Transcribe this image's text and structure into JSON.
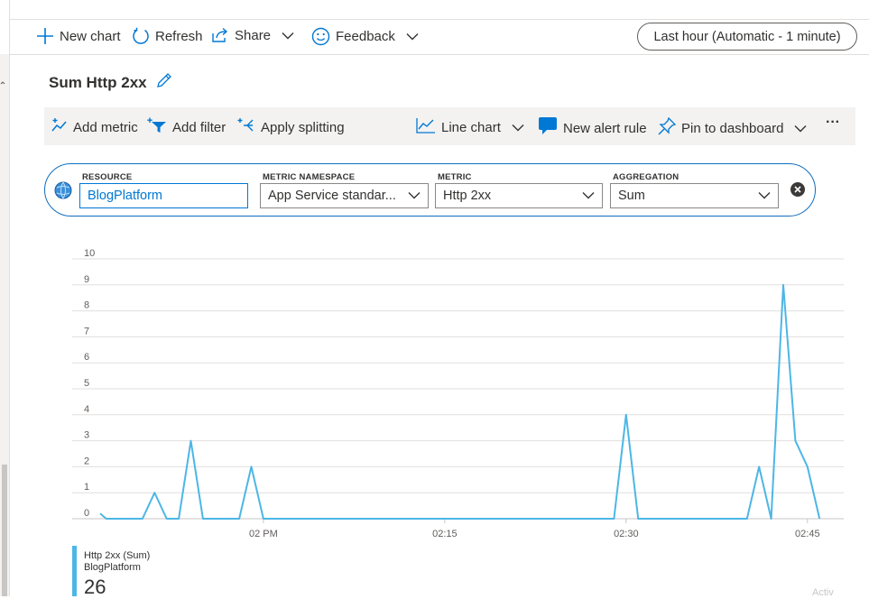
{
  "commandbar": {
    "new_chart": "New chart",
    "refresh": "Refresh",
    "share": "Share",
    "feedback": "Feedback",
    "time_range": "Last hour (Automatic - 1 minute)"
  },
  "chart_title": "Sum Http 2xx",
  "toolbar": {
    "add_metric": "Add metric",
    "add_filter": "Add filter",
    "apply_splitting": "Apply splitting",
    "line_chart": "Line chart",
    "new_alert_rule": "New alert rule",
    "pin_to_dashboard": "Pin to dashboard",
    "more": "···"
  },
  "metric_row": {
    "resource_label": "RESOURCE",
    "resource_value": "BlogPlatform",
    "namespace_label": "METRIC NAMESPACE",
    "namespace_value": "App Service standar...",
    "metric_label": "METRIC",
    "metric_value": "Http 2xx",
    "aggregation_label": "AGGREGATION",
    "aggregation_value": "Sum"
  },
  "chart_data": {
    "type": "line",
    "y_ticks": [
      "0",
      "1",
      "2",
      "3",
      "4",
      "5",
      "6",
      "7",
      "8",
      "9",
      "10"
    ],
    "ylim": [
      0,
      10
    ],
    "x_ticks": [
      {
        "label": "02 PM",
        "minute": 0
      },
      {
        "label": "02:15",
        "minute": 15
      },
      {
        "label": "02:30",
        "minute": 30
      },
      {
        "label": "02:45",
        "minute": 45
      }
    ],
    "xlim_minutes": [
      -13.5,
      48
    ],
    "grid": true,
    "color": "#4db6e6",
    "series": [
      {
        "name": "Http 2xx (Sum)",
        "points": [
          [
            -13.5,
            0.2
          ],
          [
            -13,
            0
          ],
          [
            -10,
            0
          ],
          [
            -9,
            1
          ],
          [
            -8,
            0
          ],
          [
            -7,
            0
          ],
          [
            -6,
            3
          ],
          [
            -5,
            0
          ],
          [
            -2,
            0
          ],
          [
            -1,
            2
          ],
          [
            0,
            0
          ],
          [
            29,
            0
          ],
          [
            30,
            4
          ],
          [
            31,
            0
          ],
          [
            40,
            0
          ],
          [
            41,
            2
          ],
          [
            42,
            0
          ],
          [
            43,
            9
          ],
          [
            44,
            3
          ],
          [
            45,
            2
          ],
          [
            46,
            0
          ]
        ]
      }
    ]
  },
  "legend": {
    "series_name": "Http 2xx (Sum)",
    "resource": "BlogPlatform",
    "total": "26"
  },
  "ghost_text": "Activ"
}
